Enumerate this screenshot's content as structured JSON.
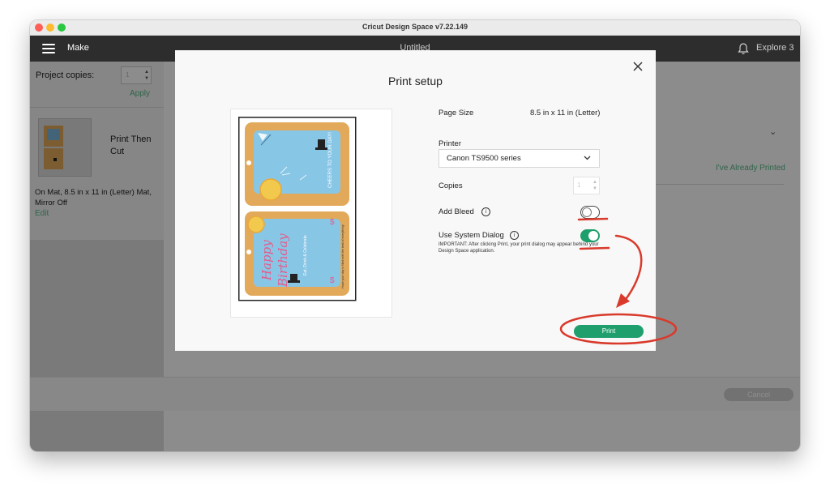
{
  "window": {
    "title": "Cricut Design Space  v7.22.149"
  },
  "header": {
    "make_label": "Make",
    "doc_title": "Untitled",
    "machine_label": "Explore 3"
  },
  "sidebar": {
    "project_copies_label": "Project copies:",
    "project_copies_value": "1",
    "apply_label": "Apply",
    "mat_title": "Print Then Cut",
    "mat_info": "On Mat, 8.5 in x 11 in (Letter) Mat, Mirror Off",
    "edit_label": "Edit"
  },
  "main": {
    "already_printed_label": "I've Already Printed",
    "cancel_label": "Cancel"
  },
  "modal": {
    "title": "Print setup",
    "page_size_label": "Page Size",
    "page_size_value": "8.5 in x 11 in (Letter)",
    "printer_label": "Printer",
    "printer_value": "Canon TS9500 series",
    "copies_label": "Copies",
    "copies_value": "1",
    "add_bleed_label": "Add Bleed",
    "add_bleed_on": false,
    "system_dialog_label": "Use System Dialog",
    "system_dialog_on": true,
    "important_note": "IMPORTANT: After clicking Print, your print dialog may appear behind your Design Space application.",
    "print_label": "Print"
  },
  "preview": {
    "card1_text": "CHEERS TO YOUR DAY!",
    "card2_word1": "Happy",
    "card2_word2": "Birthday",
    "card2_subtext": "Eat, Drink & Celebrate",
    "card2_side_text": "Hope your day is filled with the best of everything!"
  },
  "colors": {
    "accent_green": "#1f9f6c",
    "link_green": "#55b986",
    "annotation_red": "#d93a2b",
    "card_tan": "#e2a95a",
    "card_blue": "#88c6e6"
  },
  "icons": {
    "menu": "hamburger-icon",
    "bell": "bell-icon",
    "close": "close-icon",
    "dropdown": "chevron-down-icon",
    "info": "info-icon"
  }
}
